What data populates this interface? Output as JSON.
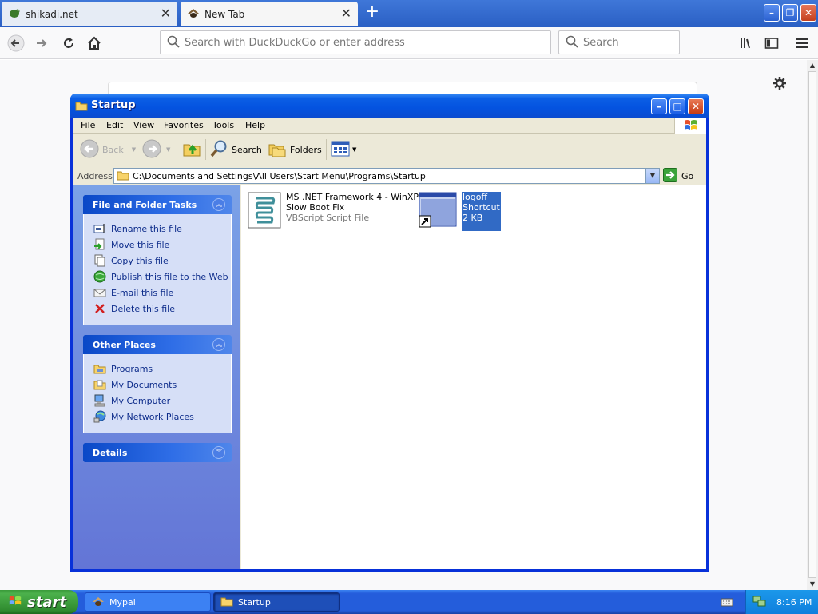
{
  "browser": {
    "tabs": [
      {
        "title": "shikadi.net",
        "active": false
      },
      {
        "title": "New Tab",
        "active": true
      }
    ],
    "url_placeholder": "Search with DuckDuckGo or enter address",
    "search_placeholder": "Search"
  },
  "explorer": {
    "title": "Startup",
    "menu": [
      "File",
      "Edit",
      "View",
      "Favorites",
      "Tools",
      "Help"
    ],
    "toolbar": {
      "back": "Back",
      "search": "Search",
      "folders": "Folders"
    },
    "address_label": "Address",
    "address_value": "C:\\Documents and Settings\\All Users\\Start Menu\\Programs\\Startup",
    "go_label": "Go",
    "panels": {
      "file_tasks": {
        "title": "File and Folder Tasks",
        "items": [
          "Rename this file",
          "Move this file",
          "Copy this file",
          "Publish this file to the Web",
          "E-mail this file",
          "Delete this file"
        ]
      },
      "other_places": {
        "title": "Other Places",
        "items": [
          "Programs",
          "My Documents",
          "My Computer",
          "My Network Places"
        ]
      },
      "details": {
        "title": "Details"
      }
    },
    "files": [
      {
        "name_line1": "MS .NET Framework 4 - WinXP",
        "name_line2": "Slow Boot Fix",
        "type": "VBScript Script File",
        "selected": false
      },
      {
        "name_line1": "logoff",
        "name_line2": "Shortcut",
        "type": "2 KB",
        "selected": true
      }
    ]
  },
  "taskbar": {
    "start_label": "start",
    "tasks": [
      {
        "label": "Mypal",
        "active": false
      },
      {
        "label": "Startup",
        "active": true
      }
    ],
    "clock": "8:16 PM"
  }
}
